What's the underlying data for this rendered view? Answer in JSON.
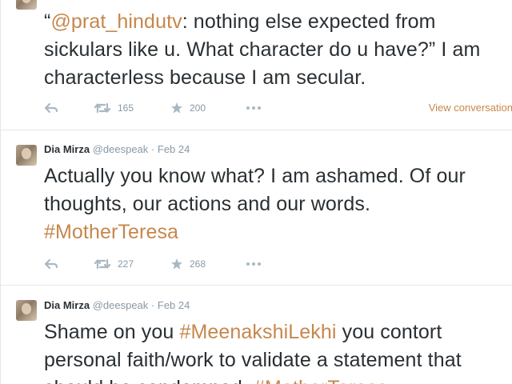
{
  "tweets": [
    {
      "text_parts": [
        {
          "text": "“",
          "type": "plain"
        },
        {
          "text": "@prat_hindutv",
          "type": "tag"
        },
        {
          "text": ":  nothing else expected from sickulars like u. What character do u have?” I am characterless because I am secular.",
          "type": "plain"
        }
      ],
      "retweets": "165",
      "favorites": "200",
      "view_conversation": "View conversation"
    },
    {
      "name": "Dia Mirza",
      "handle": "@deespeak",
      "dot": "·",
      "date": "Feb 24",
      "text_parts": [
        {
          "text": "Actually you know what? I am ashamed. Of our thoughts, our actions and our words. ",
          "type": "plain"
        },
        {
          "text": "#MotherTeresa",
          "type": "tag"
        }
      ],
      "retweets": "227",
      "favorites": "268"
    },
    {
      "name": "Dia Mirza",
      "handle": "@deespeak",
      "dot": "·",
      "date": "Feb 24",
      "text_parts": [
        {
          "text": "Shame on you ",
          "type": "plain"
        },
        {
          "text": "#MeenakshiLekhi",
          "type": "tag"
        },
        {
          "text": " you contort personal faith/work to validate a statement that should be condemned. ",
          "type": "plain"
        },
        {
          "text": "#MotherTeresa",
          "type": "tag"
        }
      ]
    }
  ],
  "icons": {
    "reply": "reply-icon",
    "retweet": "retweet-icon",
    "favorite": "star-icon",
    "more": "more-icon"
  },
  "colors": {
    "accent": "#c6874c",
    "text": "#292f33",
    "muted": "#8899a6",
    "icon": "#aab8c2",
    "border": "#e1e8ed"
  }
}
